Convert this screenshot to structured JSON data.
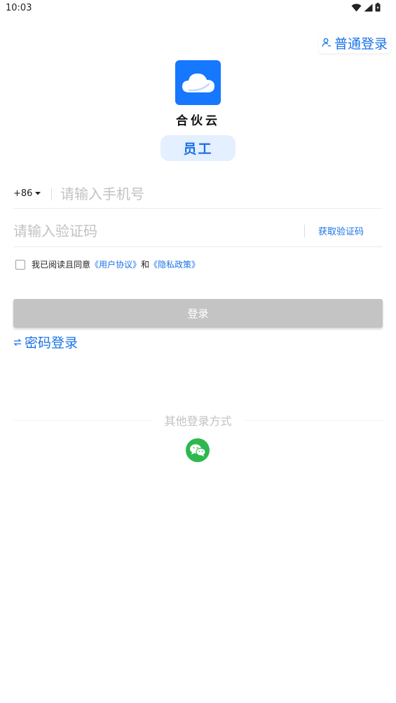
{
  "status_bar": {
    "time": "10:03"
  },
  "header": {
    "normal_login_label": "普通登录"
  },
  "app": {
    "name": "合伙云",
    "role": "员工",
    "brand_color": "#1677ff"
  },
  "form": {
    "country_code": "+86",
    "phone_placeholder": "请输入手机号",
    "code_placeholder": "请输入验证码",
    "get_code_label": "获取验证码"
  },
  "agreement": {
    "prefix": "我已阅读且同意",
    "user_agreement": "《用户协议》",
    "connector": "和",
    "privacy_policy": "《隐私政策》"
  },
  "login_button_label": "登录",
  "password_login_label": "密码登录",
  "other_login": {
    "label": "其他登录方式",
    "wechat_color": "#2db84d"
  },
  "icons": [
    "wifi-icon",
    "signal-icon",
    "battery-icon",
    "user-icon",
    "cloud-logo-icon",
    "caret-down-icon",
    "swap-icon",
    "wechat-icon"
  ]
}
